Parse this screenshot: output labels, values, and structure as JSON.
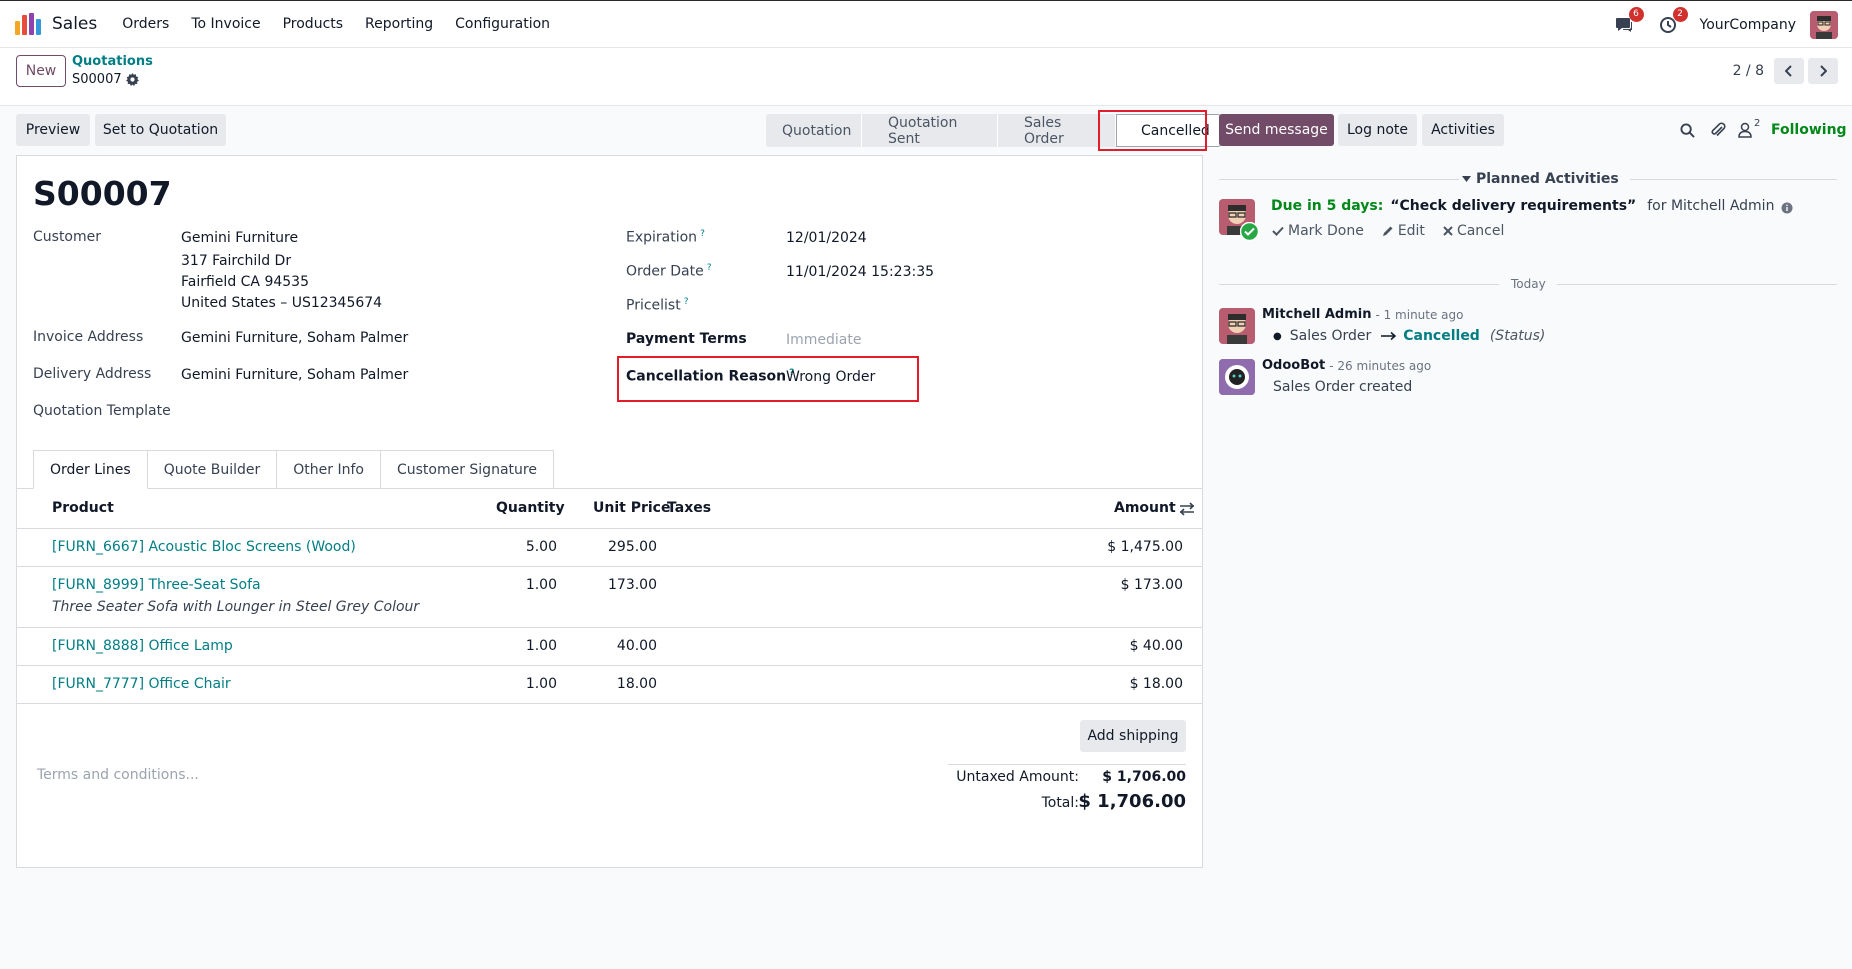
{
  "navbar": {
    "app_name": "Sales",
    "menu": [
      "Orders",
      "To Invoice",
      "Products",
      "Reporting",
      "Configuration"
    ],
    "messages_badge": "6",
    "activities_badge": "2",
    "company": "YourCompany"
  },
  "control_panel": {
    "new_label": "New",
    "breadcrumb_parent": "Quotations",
    "breadcrumb_current": "S00007",
    "pager": "2 / 8"
  },
  "actions": {
    "preview": "Preview",
    "set_to_quotation": "Set to Quotation"
  },
  "statusbar": {
    "stages": [
      "Quotation",
      "Quotation Sent",
      "Sales Order",
      "Cancelled"
    ],
    "active": "Cancelled"
  },
  "form": {
    "title": "S00007",
    "customer_label": "Customer",
    "customer_name": "Gemini Furniture",
    "customer_address": [
      "317 Fairchild Dr",
      "Fairfield CA 94535",
      "United States – US12345674"
    ],
    "invoice_address_label": "Invoice Address",
    "invoice_address": "Gemini Furniture, Soham Palmer",
    "delivery_address_label": "Delivery Address",
    "delivery_address": "Gemini Furniture, Soham Palmer",
    "quotation_template_label": "Quotation Template",
    "expiration_label": "Expiration",
    "expiration": "12/01/2024",
    "order_date_label": "Order Date",
    "order_date": "11/01/2024 15:23:35",
    "pricelist_label": "Pricelist",
    "payment_terms_label": "Payment Terms",
    "payment_terms": "Immediate",
    "cancellation_reason_label": "Cancellation Reason",
    "cancellation_reason": "Wrong Order",
    "help_mark": "?"
  },
  "tabs": [
    "Order Lines",
    "Quote Builder",
    "Other Info",
    "Customer Signature"
  ],
  "table": {
    "headers": {
      "product": "Product",
      "quantity": "Quantity",
      "unit_price": "Unit Price",
      "taxes": "Taxes",
      "amount": "Amount"
    },
    "rows": [
      {
        "product": "[FURN_6667] Acoustic Bloc Screens (Wood)",
        "description": "",
        "quantity": "5.00",
        "unit_price": "295.00",
        "amount": "$ 1,475.00"
      },
      {
        "product": "[FURN_8999] Three-Seat Sofa",
        "description": "Three Seater Sofa with Lounger in Steel Grey Colour",
        "quantity": "1.00",
        "unit_price": "173.00",
        "amount": "$ 173.00"
      },
      {
        "product": "[FURN_8888] Office Lamp",
        "description": "",
        "quantity": "1.00",
        "unit_price": "40.00",
        "amount": "$ 40.00"
      },
      {
        "product": "[FURN_7777] Office Chair",
        "description": "",
        "quantity": "1.00",
        "unit_price": "18.00",
        "amount": "$ 18.00"
      }
    ]
  },
  "footer": {
    "add_shipping": "Add shipping",
    "terms_placeholder": "Terms and conditions...",
    "untaxed_label": "Untaxed Amount:",
    "untaxed_value": "$ 1,706.00",
    "total_label": "Total:",
    "total_value": "$ 1,706.00"
  },
  "chatter": {
    "send_message": "Send message",
    "log_note": "Log note",
    "activities": "Activities",
    "followers_count": "2",
    "following": "Following",
    "planned_activities": "Planned Activities",
    "activity_due": "Due in 5 days:",
    "activity_summary": "“Check delivery requirements”",
    "activity_for": "for Mitchell Admin",
    "mark_done": "Mark Done",
    "edit": "Edit",
    "cancel": "Cancel",
    "today": "Today",
    "messages": [
      {
        "author": "Mitchell Admin",
        "time": "- 1 minute ago",
        "old_value": "Sales Order",
        "new_value": "Cancelled",
        "field": "(Status)"
      },
      {
        "author": "OdooBot",
        "time": "- 26 minutes ago",
        "body": "Sales Order created"
      }
    ]
  },
  "colors": {
    "brand": "#714b67",
    "link": "#017e84",
    "success": "#008818",
    "highlight": "#e11d2a"
  }
}
